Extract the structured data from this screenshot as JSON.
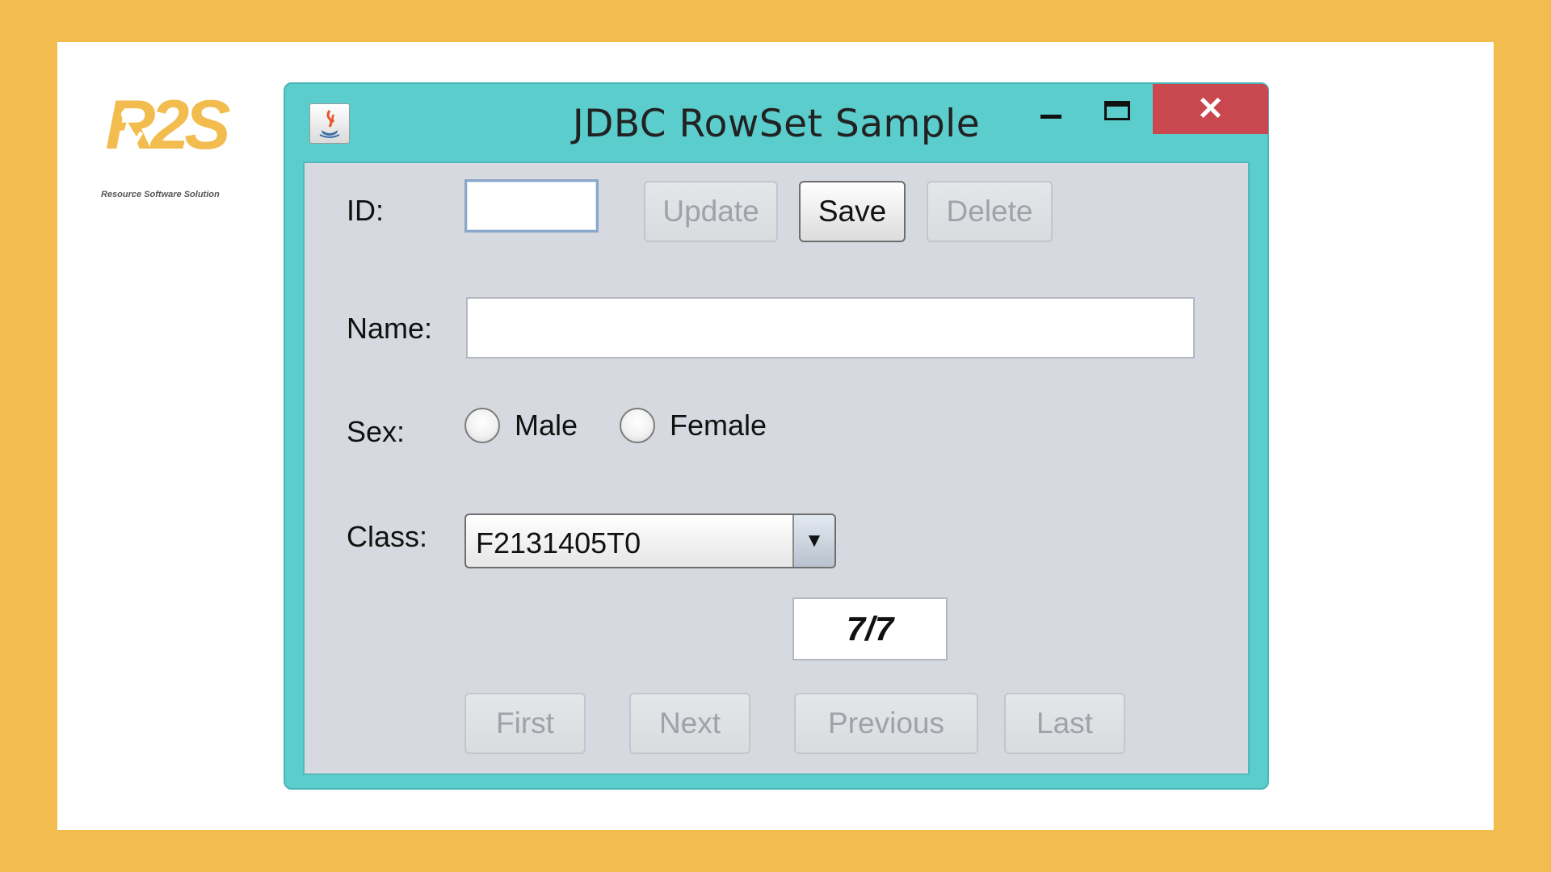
{
  "brand": {
    "logo_text": "R2S",
    "tagline": "Resource Software Solution",
    "color": "#F2BC4E"
  },
  "window": {
    "title": "JDBC RowSet Sample",
    "icon": "java-coffee-icon",
    "minimize_icon": "minimize-icon",
    "maximize_icon": "maximize-icon",
    "close_symbol": "✕"
  },
  "form": {
    "id_label": "ID:",
    "id_value": "",
    "name_label": "Name:",
    "name_value": "",
    "sex_label": "Sex:",
    "sex_options": [
      "Male",
      "Female"
    ],
    "class_label": "Class:",
    "class_value": "F2131405T0",
    "class_arrow": "▼"
  },
  "actions": {
    "update": "Update",
    "save": "Save",
    "delete": "Delete"
  },
  "navigation": {
    "first": "First",
    "next": "Next",
    "previous": "Previous",
    "last": "Last",
    "position": "7/7"
  }
}
